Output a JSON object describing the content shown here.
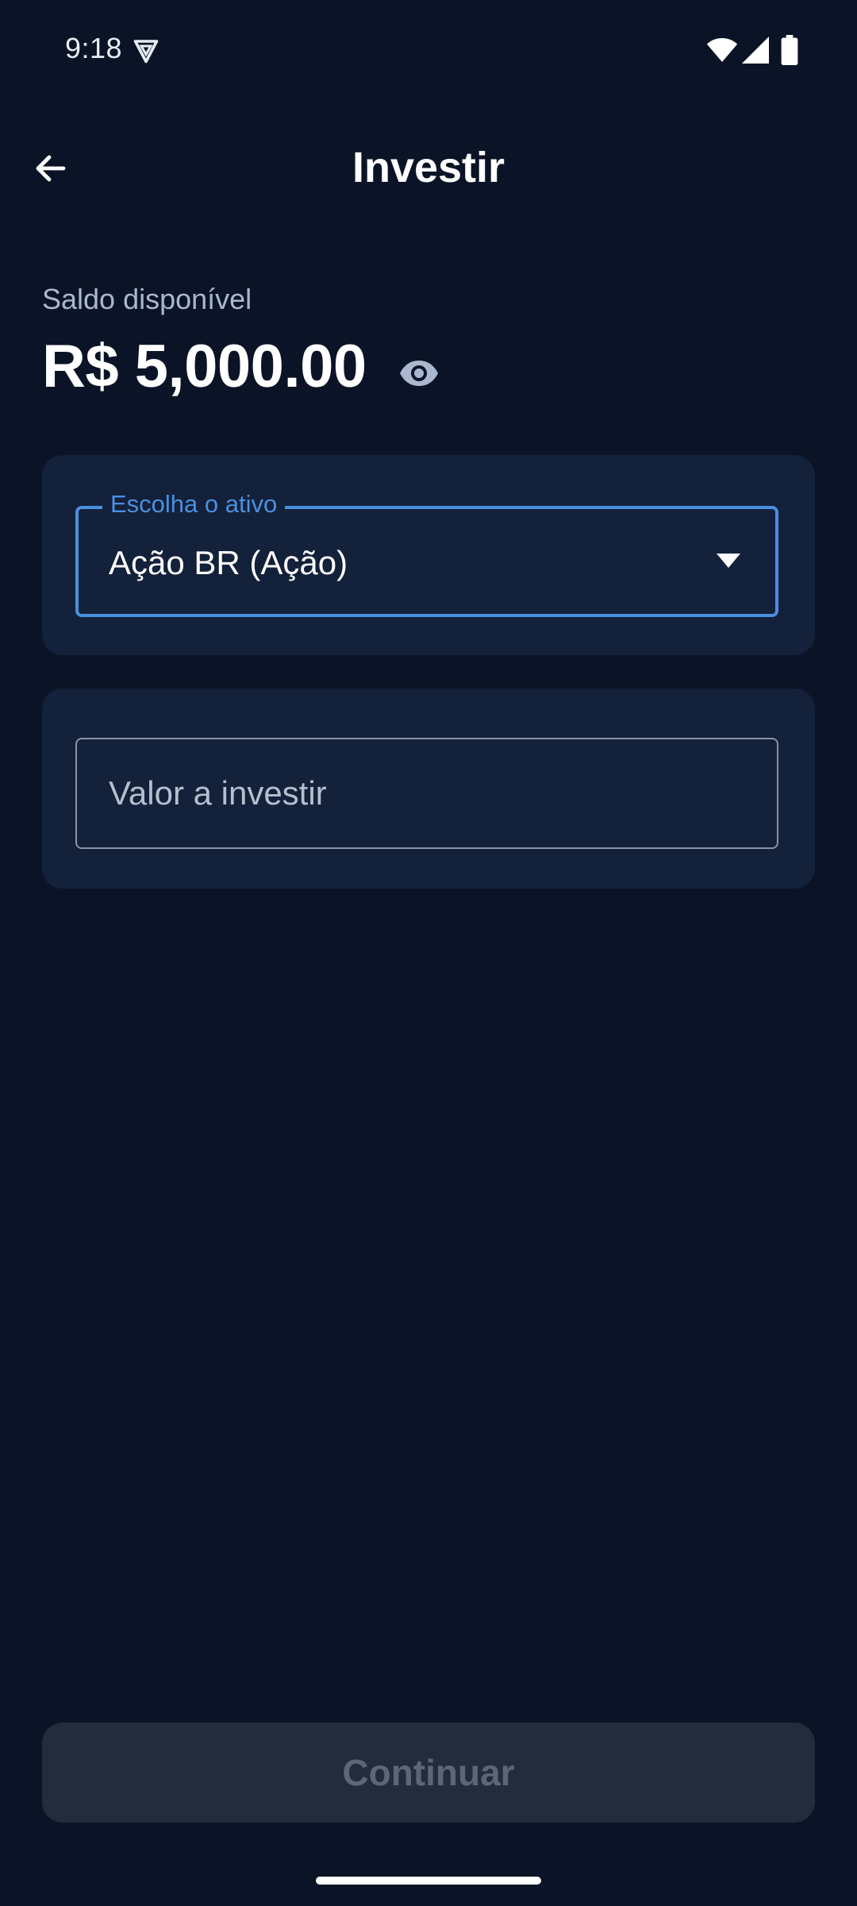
{
  "status_bar": {
    "time": "9:18"
  },
  "app_bar": {
    "title": "Investir"
  },
  "balance": {
    "label": "Saldo disponível",
    "value": "R$ 5,000.00"
  },
  "asset_select": {
    "label": "Escolha o ativo",
    "value": "Ação BR (Ação)"
  },
  "amount_input": {
    "placeholder": "Valor a investir",
    "value": ""
  },
  "actions": {
    "continue_label": "Continuar"
  },
  "colors": {
    "background": "#0b1426",
    "card": "#14213a",
    "accent": "#4a8fe0",
    "disabled_button": "#232c3b"
  },
  "icons": {
    "back": "arrow-left-icon",
    "visibility": "eye-icon",
    "dropdown": "caret-down-icon",
    "vpn": "vpn-shield-icon",
    "wifi": "wifi-icon",
    "signal": "cellular-signal-icon",
    "battery": "battery-icon"
  }
}
